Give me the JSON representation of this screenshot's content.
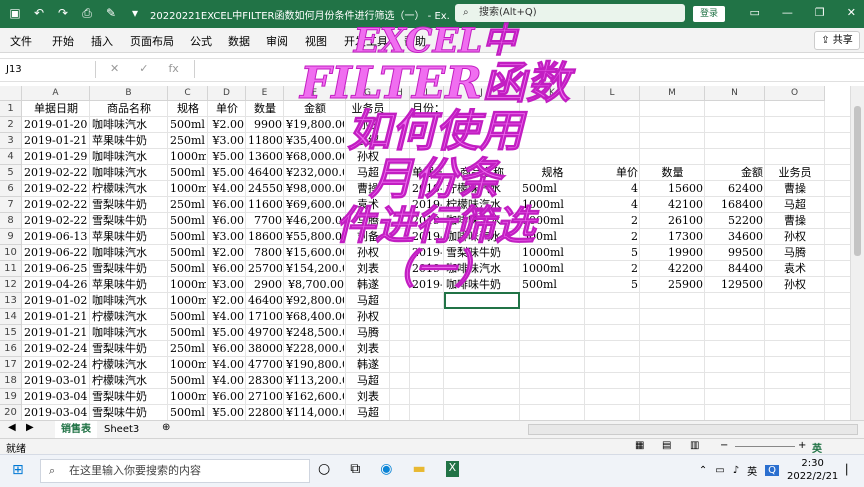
{
  "titlebar": {
    "title": "20220221EXCEL中FILTER函数如何月份条件进行筛选（一） - Ex...",
    "search_placeholder": "搜索(Alt+Q)",
    "login_label": "登录"
  },
  "menu": [
    "文件",
    "开始",
    "插入",
    "页面布局",
    "公式",
    "数据",
    "审阅",
    "视图",
    "开发工具",
    "帮助"
  ],
  "share_label": "共享",
  "formula_bar": {
    "name_box": "J13",
    "fx_label": "fx",
    "content": ""
  },
  "columns": [
    "A",
    "B",
    "C",
    "D",
    "E",
    "F",
    "G",
    "H",
    "I",
    "J",
    "K",
    "L",
    "M",
    "N",
    "O"
  ],
  "rows": [
    "1",
    "2",
    "3",
    "4",
    "5",
    "6",
    "7",
    "8",
    "9",
    "10",
    "11",
    "12",
    "13",
    "14",
    "15",
    "16",
    "17",
    "18",
    "19",
    "20",
    "21"
  ],
  "left_table": {
    "headers": [
      "单据日期",
      "商品名称",
      "规格",
      "单价",
      "数量",
      "金额",
      "业务员"
    ],
    "rows": [
      [
        "2019-01-20",
        "咖啡味汽水",
        "500ml",
        "¥2.00",
        "9900",
        "¥19,800.00",
        "孙权"
      ],
      [
        "2019-01-21",
        "苹果味牛奶",
        "250ml",
        "¥3.00",
        "11800",
        "¥35,400.00",
        "袁绍"
      ],
      [
        "2019-01-29",
        "咖啡味汽水",
        "1000ml",
        "¥5.00",
        "13600",
        "¥68,000.00",
        "孙权"
      ],
      [
        "2019-02-22",
        "咖啡味汽水",
        "500ml",
        "¥5.00",
        "46400",
        "¥232,000.00",
        "马超"
      ],
      [
        "2019-02-22",
        "柠檬味汽水",
        "1000ml",
        "¥4.00",
        "24550",
        "¥98,000.00",
        "曹操"
      ],
      [
        "2019-02-22",
        "雪梨味牛奶",
        "250ml",
        "¥6.00",
        "11600",
        "¥69,600.00",
        "袁术"
      ],
      [
        "2019-02-22",
        "雪梨味牛奶",
        "500ml",
        "¥6.00",
        "7700",
        "¥46,200.00",
        "马腾"
      ],
      [
        "2019-06-13",
        "苹果味牛奶",
        "500ml",
        "¥3.00",
        "18600",
        "¥55,800.00",
        "刘备"
      ],
      [
        "2019-06-22",
        "咖啡味汽水",
        "500ml",
        "¥2.00",
        "7800",
        "¥15,600.00",
        "孙权"
      ],
      [
        "2019-06-25",
        "雪梨味牛奶",
        "500ml",
        "¥6.00",
        "25700",
        "¥154,200.00",
        "刘表"
      ],
      [
        "2019-04-26",
        "苹果味牛奶",
        "1000ml",
        "¥3.00",
        "2900",
        "¥8,700.00",
        "韩遂"
      ],
      [
        "2019-01-02",
        "咖啡味汽水",
        "1000ml",
        "¥2.00",
        "46400",
        "¥92,800.00",
        "马超"
      ],
      [
        "2019-01-21",
        "柠檬味汽水",
        "500ml",
        "¥4.00",
        "17100",
        "¥68,400.00",
        "孙权"
      ],
      [
        "2019-01-21",
        "咖啡味汽水",
        "500ml",
        "¥5.00",
        "49700",
        "¥248,500.00",
        "马腾"
      ],
      [
        "2019-02-24",
        "雪梨味牛奶",
        "250ml",
        "¥6.00",
        "38000",
        "¥228,000.00",
        "刘表"
      ],
      [
        "2019-02-24",
        "柠檬味汽水",
        "1000ml",
        "¥4.00",
        "47700",
        "¥190,800.00",
        "韩遂"
      ],
      [
        "2019-03-01",
        "柠檬味汽水",
        "500ml",
        "¥4.00",
        "28300",
        "¥113,200.00",
        "马超"
      ],
      [
        "2019-03-04",
        "雪梨味牛奶",
        "1000ml",
        "¥6.00",
        "27100",
        "¥162,600.00",
        "刘表"
      ],
      [
        "2019-03-04",
        "雪梨味牛奶",
        "500ml",
        "¥5.00",
        "22800",
        "¥114,000.00",
        "马超"
      ],
      [
        "2019-03-10",
        "咖啡味汽水",
        "1000ml",
        "¥2.00",
        "8400",
        "¥16,800.00",
        "马超"
      ]
    ]
  },
  "criteria": {
    "label": "月份："
  },
  "right_table": {
    "headers": [
      "单据日期",
      "商品名称",
      "规格",
      "单价",
      "数量",
      "金额",
      "业务员"
    ],
    "rows": [
      [
        "2019-05-14",
        "柠檬味汽水",
        "500ml",
        "4",
        "15600",
        "62400",
        "曹操"
      ],
      [
        "2019-05-29",
        "柠檬味汽水",
        "1000ml",
        "4",
        "42100",
        "168400",
        "马超"
      ],
      [
        "2019-05-09",
        "咖啡味汽水",
        "1000ml",
        "2",
        "26100",
        "52200",
        "曹操"
      ],
      [
        "2019-05-23",
        "咖啡味汽水",
        "500ml",
        "2",
        "17300",
        "34600",
        "孙权"
      ],
      [
        "2019-05-09",
        "雪梨味牛奶",
        "1000ml",
        "5",
        "19900",
        "99500",
        "马腾"
      ],
      [
        "2019-05-31",
        "咖啡味汽水",
        "1000ml",
        "2",
        "42200",
        "84400",
        "袁术"
      ],
      [
        "2019-05-10",
        "咖啡味牛奶",
        "500ml",
        "5",
        "25900",
        "129500",
        "孙权"
      ]
    ]
  },
  "overlay_lines": [
    "EXCEL中",
    "FILTER函数",
    "如何使用",
    "月份条",
    "件进行筛选",
    "（一）"
  ],
  "sheets": [
    "销售表",
    "Sheet3"
  ],
  "status": {
    "ready": "就绪",
    "zoom": "英"
  },
  "taskbar": {
    "search_placeholder": "在这里输入你要搜索的内容",
    "ime": "英",
    "time": "2:30",
    "date": "2022/2/21",
    "notif": "Q"
  }
}
